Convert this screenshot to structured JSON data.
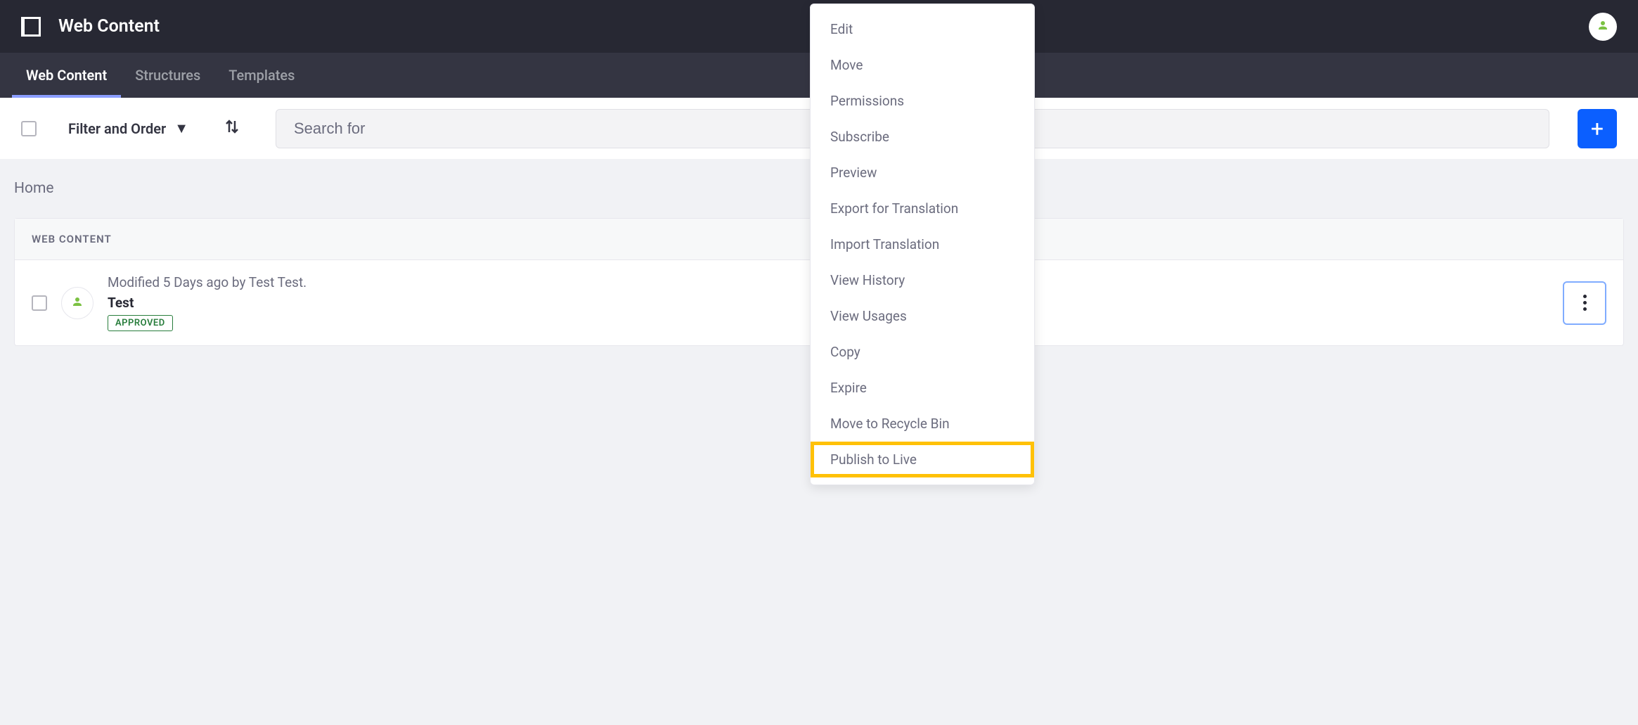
{
  "header": {
    "title": "Web Content"
  },
  "tabs": [
    {
      "label": "Web Content",
      "active": true
    },
    {
      "label": "Structures",
      "active": false
    },
    {
      "label": "Templates",
      "active": false
    }
  ],
  "toolbar": {
    "filter_label": "Filter and Order",
    "search_placeholder": "Search for"
  },
  "breadcrumb": {
    "home": "Home"
  },
  "section": {
    "title": "WEB CONTENT"
  },
  "content_item": {
    "modified": "Modified 5 Days ago by Test Test.",
    "title": "Test",
    "status": "APPROVED"
  },
  "dropdown": {
    "items": [
      "Edit",
      "Move",
      "Permissions",
      "Subscribe",
      "Preview",
      "Export for Translation",
      "Import Translation",
      "View History",
      "View Usages",
      "Copy",
      "Expire",
      "Move to Recycle Bin",
      "Publish to Live"
    ],
    "highlighted_index": 12
  }
}
